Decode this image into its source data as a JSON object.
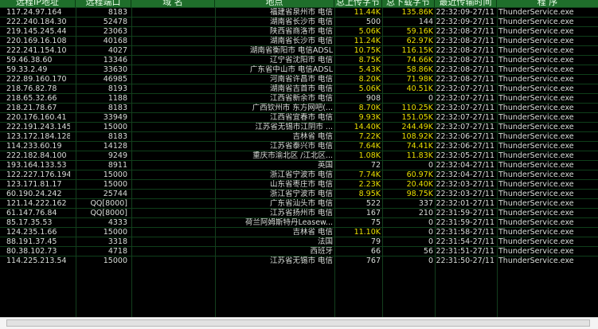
{
  "header": {
    "remote_ip": "远程IP地址",
    "remote_port": "远程端口",
    "name": "域 名",
    "location": "地点",
    "upload": "总上传字节",
    "download": "总下载字节",
    "last_time": "最近传输时间",
    "program": "程 序"
  },
  "rows": [
    {
      "ip": "117.24.97.164",
      "port": "8183",
      "loc": "福建省泉州市 电信",
      "up": "11.44K",
      "down": "135.86K",
      "time": "22:32:09-27/11",
      "proc": "ThunderService.exe",
      "hu": true,
      "hd": true
    },
    {
      "ip": "222.240.184.30",
      "port": "52478",
      "loc": "湖南省长沙市 电信",
      "up": "500",
      "down": "144",
      "time": "22:32:09-27/11",
      "proc": "ThunderService.exe",
      "hu": false,
      "hd": false
    },
    {
      "ip": "219.145.245.44",
      "port": "23063",
      "loc": "陕西省商洛市 电信",
      "up": "5.06K",
      "down": "59.16K",
      "time": "22:32:08-27/11",
      "proc": "ThunderService.exe",
      "hu": true,
      "hd": true
    },
    {
      "ip": "220.169.16.108",
      "port": "40168",
      "loc": "湖南省长沙市 电信",
      "up": "11.24K",
      "down": "62.97K",
      "time": "22:32:08-27/11",
      "proc": "ThunderService.exe",
      "hu": true,
      "hd": true
    },
    {
      "ip": "222.241.154.10",
      "port": "4027",
      "loc": "湖南省衡阳市 电信ADSL",
      "up": "10.75K",
      "down": "116.15K",
      "time": "22:32:08-27/11",
      "proc": "ThunderService.exe",
      "hu": true,
      "hd": true
    },
    {
      "ip": "59.46.38.60",
      "port": "13346",
      "loc": "辽宁省沈阳市 电信",
      "up": "8.75K",
      "down": "74.66K",
      "time": "22:32:08-27/11",
      "proc": "ThunderService.exe",
      "hu": true,
      "hd": true
    },
    {
      "ip": "59.33.2.49",
      "port": "33630",
      "loc": "广东省中山市 电信ADSL",
      "up": "5.43K",
      "down": "58.86K",
      "time": "22:32:08-27/11",
      "proc": "ThunderService.exe",
      "hu": true,
      "hd": true
    },
    {
      "ip": "222.89.160.170",
      "port": "46985",
      "loc": "河南省许昌市 电信",
      "up": "8.20K",
      "down": "71.98K",
      "time": "22:32:08-27/11",
      "proc": "ThunderService.exe",
      "hu": true,
      "hd": true
    },
    {
      "ip": "218.76.82.78",
      "port": "8193",
      "loc": "湖南省吉首市 电信",
      "up": "5.06K",
      "down": "40.51K",
      "time": "22:32:07-27/11",
      "proc": "ThunderService.exe",
      "hu": true,
      "hd": true
    },
    {
      "ip": "218.65.32.66",
      "port": "1188",
      "loc": "江西省新余市 电信",
      "up": "908",
      "down": "0",
      "time": "22:32:07-27/11",
      "proc": "ThunderService.exe",
      "hu": false,
      "hd": false
    },
    {
      "ip": "218.21.78.67",
      "port": "8183",
      "loc": "广西钦州市 东方网吧(...",
      "up": "8.70K",
      "down": "110.25K",
      "time": "22:32:07-27/11",
      "proc": "ThunderService.exe",
      "hu": true,
      "hd": true
    },
    {
      "ip": "220.176.160.41",
      "port": "33949",
      "loc": "江西省宜春市 电信",
      "up": "9.93K",
      "down": "151.05K",
      "time": "22:32:07-27/11",
      "proc": "ThunderService.exe",
      "hu": true,
      "hd": true
    },
    {
      "ip": "222.191.243.145",
      "port": "15000",
      "loc": "江苏省无锡市江阴市 ...",
      "up": "14.40K",
      "down": "244.49K",
      "time": "22:32:07-27/11",
      "proc": "ThunderService.exe",
      "hu": true,
      "hd": true
    },
    {
      "ip": "123.172.184.128",
      "port": "8183",
      "loc": "吉林省 电信",
      "up": "7.22K",
      "down": "108.92K",
      "time": "22:32:06-27/11",
      "proc": "ThunderService.exe",
      "hu": true,
      "hd": true
    },
    {
      "ip": "114.233.60.19",
      "port": "14128",
      "loc": "江苏省泰兴市 电信",
      "up": "7.64K",
      "down": "74.41K",
      "time": "22:32:06-27/11",
      "proc": "ThunderService.exe",
      "hu": true,
      "hd": true
    },
    {
      "ip": "222.182.84.100",
      "port": "9249",
      "loc": "重庆市渝北区 /江北区...",
      "up": "1.08K",
      "down": "11.83K",
      "time": "22:32:05-27/11",
      "proc": "ThunderService.exe",
      "hu": true,
      "hd": true
    },
    {
      "ip": "193.164.133.53",
      "port": "8911",
      "loc": "英国",
      "up": "72",
      "down": "0",
      "time": "22:32:04-27/11",
      "proc": "ThunderService.exe",
      "hu": false,
      "hd": false
    },
    {
      "ip": "122.227.176.194",
      "port": "15000",
      "loc": "浙江省宁波市 电信",
      "up": "7.74K",
      "down": "60.97K",
      "time": "22:32:04-27/11",
      "proc": "ThunderService.exe",
      "hu": true,
      "hd": true
    },
    {
      "ip": "123.171.81.17",
      "port": "15000",
      "loc": "山东省枣庄市 电信",
      "up": "2.23K",
      "down": "20.40K",
      "time": "22:32:03-27/11",
      "proc": "ThunderService.exe",
      "hu": true,
      "hd": true
    },
    {
      "ip": "60.190.24.242",
      "port": "25744",
      "loc": "浙江省宁波市 电信",
      "up": "8.95K",
      "down": "98.75K",
      "time": "22:32:03-27/11",
      "proc": "ThunderService.exe",
      "hu": true,
      "hd": true
    },
    {
      "ip": "121.14.222.162",
      "port": "QQ[8000]",
      "loc": "广东省汕头市 电信",
      "up": "522",
      "down": "337",
      "time": "22:32:01-27/11",
      "proc": "ThunderService.exe",
      "hu": false,
      "hd": false
    },
    {
      "ip": "61.147.76.84",
      "port": "QQ[8000]",
      "loc": "江苏省扬州市 电信",
      "up": "167",
      "down": "210",
      "time": "22:31:59-27/11",
      "proc": "ThunderService.exe",
      "hu": false,
      "hd": false
    },
    {
      "ip": "85.17.35.53",
      "port": "4333",
      "loc": "荷兰阿姆斯特丹Leasew...",
      "up": "75",
      "down": "0",
      "time": "22:31:59-27/11",
      "proc": "ThunderService.exe",
      "hu": false,
      "hd": false
    },
    {
      "ip": "124.235.1.66",
      "port": "15000",
      "loc": "吉林省 电信",
      "up": "11.10K",
      "down": "0",
      "time": "22:31:58-27/11",
      "proc": "ThunderService.exe",
      "hu": true,
      "hd": false
    },
    {
      "ip": "88.191.37.45",
      "port": "3318",
      "loc": "法国",
      "up": "79",
      "down": "0",
      "time": "22:31:54-27/11",
      "proc": "ThunderService.exe",
      "hu": false,
      "hd": false
    },
    {
      "ip": "80.38.102.73",
      "port": "4718",
      "loc": "西班牙",
      "up": "66",
      "down": "56",
      "time": "22:31:51-27/11",
      "proc": "ThunderService.exe",
      "hu": false,
      "hd": false
    },
    {
      "ip": "114.225.213.54",
      "port": "15000",
      "loc": "江苏省无锡市 电信",
      "up": "767",
      "down": "0",
      "time": "22:31:50-27/11",
      "proc": "ThunderService.exe",
      "hu": false,
      "hd": false
    }
  ],
  "colors": {
    "header_bg": "#1f6e2b",
    "highlight": "#e8e000",
    "text": "#d9ded9"
  }
}
